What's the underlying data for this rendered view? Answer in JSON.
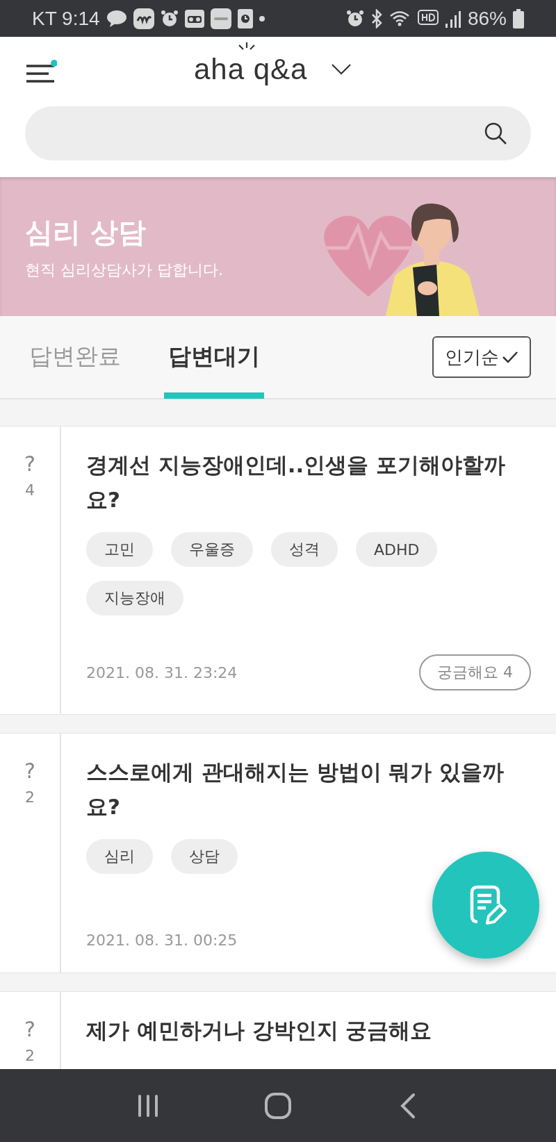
{
  "status_bar": {
    "carrier_time": "KT 9:14",
    "battery": "86%"
  },
  "header": {
    "logo": "aha q&a",
    "menu_badge": true
  },
  "banner": {
    "title": "심리 상담",
    "subtitle": "현직 심리상담사가 답합니다."
  },
  "tabs": [
    {
      "label": "답변완료",
      "selected": false
    },
    {
      "label": "답변대기",
      "selected": true
    }
  ],
  "sort": {
    "label": "인기순",
    "checked": true
  },
  "questions": [
    {
      "mark": "?",
      "count": "4",
      "title": "경계선 지능장애인데..인생을 포기해야할까요?",
      "tags": [
        "고민",
        "우울증",
        "성격",
        "ADHD",
        "지능장애"
      ],
      "date": "2021. 08. 31. 23:24",
      "curious": "궁금해요 4"
    },
    {
      "mark": "?",
      "count": "2",
      "title": "스스로에게 관대해지는 방법이 뭐가 있을까요?",
      "tags": [
        "심리",
        "상담"
      ],
      "date": "2021. 08. 31. 00:25"
    },
    {
      "mark": "?",
      "count": "2",
      "title": "제가 예민하거나 강박인지 궁금해요"
    }
  ]
}
